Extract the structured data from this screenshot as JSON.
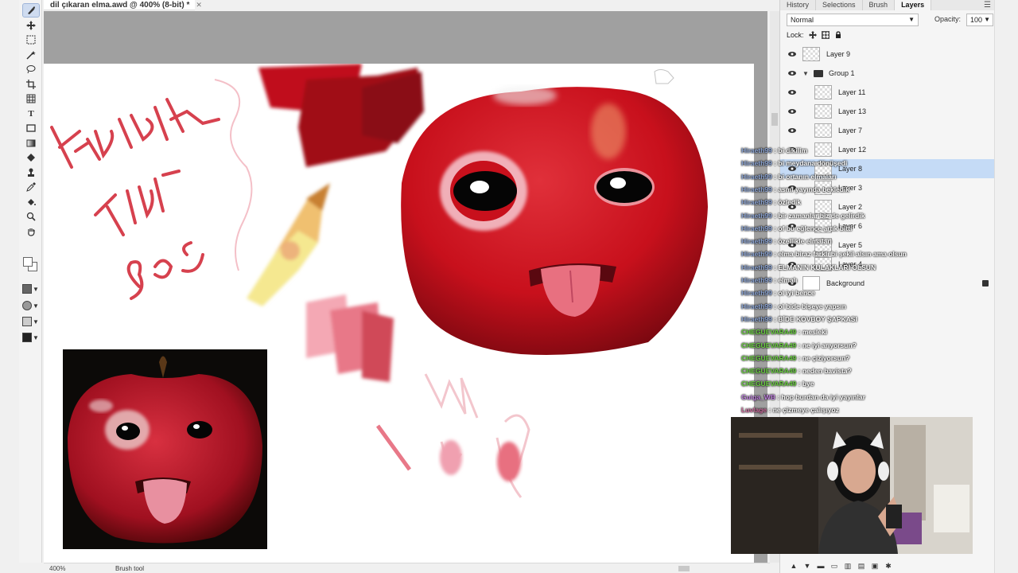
{
  "document": {
    "tab_title": "dil çıkaran elma.awd @ 400% (8-bit) *",
    "close_glyph": "✕"
  },
  "status": {
    "zoom": "400%",
    "tool": "Brush tool"
  },
  "panel_tabs": [
    {
      "label": "History",
      "active": false
    },
    {
      "label": "Selections",
      "active": false
    },
    {
      "label": "Brush",
      "active": false
    },
    {
      "label": "Layers",
      "active": true
    }
  ],
  "layers_panel": {
    "blend_mode": "Normal",
    "opacity_label": "Opacity:",
    "opacity_value": "100",
    "lock_label": "Lock:",
    "layers": [
      {
        "name": "Layer 9",
        "indent": 0,
        "type": "layer",
        "selected": false
      },
      {
        "name": "Group 1",
        "indent": 0,
        "type": "group",
        "selected": false
      },
      {
        "name": "Layer 11",
        "indent": 1,
        "type": "layer",
        "selected": false
      },
      {
        "name": "Layer 13",
        "indent": 1,
        "type": "layer",
        "selected": false
      },
      {
        "name": "Layer 7",
        "indent": 1,
        "type": "layer",
        "selected": false
      },
      {
        "name": "Layer 12",
        "indent": 1,
        "type": "layer",
        "selected": false
      },
      {
        "name": "Layer 8",
        "indent": 1,
        "type": "layer",
        "selected": true
      },
      {
        "name": "Layer 3",
        "indent": 1,
        "type": "layer",
        "selected": false
      },
      {
        "name": "Layer 2",
        "indent": 1,
        "type": "layer",
        "selected": false
      },
      {
        "name": "Layer 6",
        "indent": 1,
        "type": "layer",
        "selected": false
      },
      {
        "name": "Layer 5",
        "indent": 1,
        "type": "layer",
        "selected": false
      },
      {
        "name": "Layer 4",
        "indent": 1,
        "type": "layer",
        "selected": false
      },
      {
        "name": "Background",
        "indent": 0,
        "type": "background",
        "selected": false
      }
    ]
  },
  "chat": [
    {
      "user": "Hiraeth99",
      "text": "bi dikilim",
      "color": "#8fa8d8"
    },
    {
      "user": "Hiraeth99",
      "text": "bi meydana dönüşedi",
      "color": "#8fa8d8"
    },
    {
      "user": "Hiraeth99",
      "text": "bi ortanın elmaları",
      "color": "#8fa8d8"
    },
    {
      "user": "Hiraeth99",
      "text": "asmı yayında bekledik",
      "color": "#8fa8d8"
    },
    {
      "user": "Hiraeth99",
      "text": "özledik",
      "color": "#8fa8d8"
    },
    {
      "user": "Hiraeth99",
      "text": "bir zamanlar biz de gelirdik",
      "color": "#8fa8d8"
    },
    {
      "user": "Hiraeth99",
      "text": "of bu eğlence artık bitti",
      "color": "#8fa8d8"
    },
    {
      "user": "Hiraeth99",
      "text": "özellikle elmaları",
      "color": "#8fa8d8"
    },
    {
      "user": "Hiraeth99",
      "text": "elma biraz farklı bi şekil alsın ama olsun",
      "color": "#8fa8d8"
    },
    {
      "user": "Hiraeth99",
      "text": "ELMANIN KULAKLARI OLSUN",
      "color": "#8fa8d8"
    },
    {
      "user": "Hiraeth99",
      "text": "elmalı",
      "color": "#8fa8d8"
    },
    {
      "user": "Hiraeth99",
      "text": "ol iyi bence",
      "color": "#8fa8d8"
    },
    {
      "user": "Hiraeth99",
      "text": "ol bide bişeye yapsın",
      "color": "#8fa8d8"
    },
    {
      "user": "Hiraeth99",
      "text": "BİDE KOVBOY ŞAPKASI",
      "color": "#8fa8d8"
    },
    {
      "user": "CHEGUEVARA49",
      "text": "mesleki",
      "color": "#6ad040"
    },
    {
      "user": "CHEGUEVARA49",
      "text": "ne iyi arıyorsun?",
      "color": "#6ad040"
    },
    {
      "user": "CHEGUEVARA49",
      "text": "ne çiziyorsun?",
      "color": "#6ad040"
    },
    {
      "user": "CHEGUEVARA49",
      "text": "neden bavista?",
      "color": "#6ad040"
    },
    {
      "user": "CHEGUEVARA49",
      "text": "bye",
      "color": "#6ad040"
    },
    {
      "user": "Guiga_WB",
      "text": "hop burdan da iyi yayınlar",
      "color": "#c080e0"
    },
    {
      "user": "Luvlage",
      "text": "ne çizmeye çalışıyoz",
      "color": "#d070a0"
    }
  ],
  "tools": [
    "brush",
    "move",
    "marquee",
    "magic-wand",
    "lasso",
    "crop",
    "grid",
    "text",
    "shape",
    "gradient",
    "eraser",
    "stamp",
    "eyedropper",
    "fill",
    "zoom",
    "hand"
  ],
  "colors": {
    "accent_selected": "#c5dbf6",
    "apple_red": "#c8101c",
    "canvas_bg": "#a0a0a0"
  }
}
